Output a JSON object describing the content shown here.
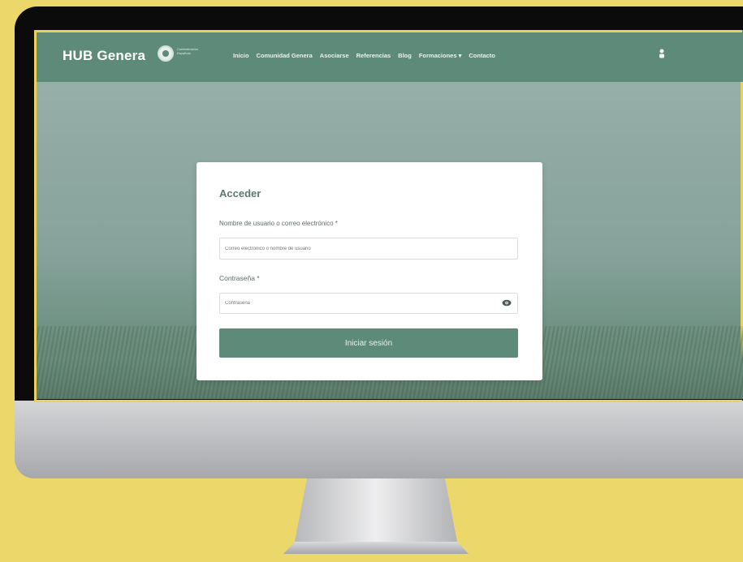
{
  "nav": {
    "brand": "HUB Genera",
    "logo_caption": "Confederación Española",
    "items": [
      "Inicio",
      "Comunidad Genera",
      "Asociarse",
      "Referencias",
      "Blog",
      "Formaciones ▾",
      "Contacto"
    ]
  },
  "login": {
    "title": "Acceder",
    "username_label": "Nombre de usuario o correo electrónico *",
    "username_placeholder": "Correo electrónico o nombre de usuario",
    "password_label": "Contraseña *",
    "password_placeholder": "Contraseña",
    "submit_label": "Iniciar sesión"
  },
  "colors": {
    "background": "#ecd86a",
    "accent": "#5e8a79"
  },
  "icons": [
    "user-icon",
    "eye-icon",
    "logo-icon"
  ]
}
